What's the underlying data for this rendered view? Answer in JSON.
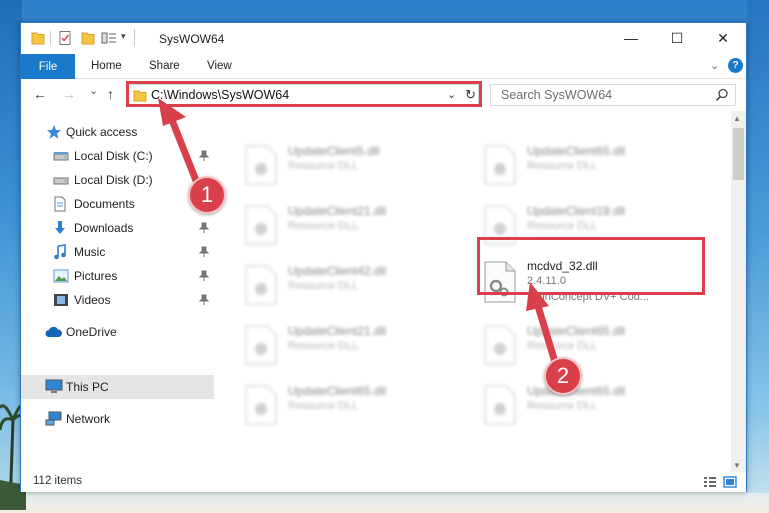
{
  "window": {
    "title": "SysWOW64",
    "minimize_glyph": "—",
    "maximize_glyph": "☐",
    "close_glyph": "✕"
  },
  "ribbon": {
    "tabs": [
      "File",
      "Home",
      "Share",
      "View"
    ],
    "collapse_glyph": "⌄",
    "help_glyph": "?"
  },
  "nav": {
    "back_glyph": "←",
    "forward_glyph": "→",
    "recent_glyph": "⌄",
    "up_glyph": "↑",
    "address": "C:\\Windows\\SysWOW64",
    "address_dropdown_glyph": "⌄",
    "refresh_glyph": "↻",
    "search_placeholder": "Search SysWOW64"
  },
  "sidebar": {
    "items": [
      {
        "label": "Quick access",
        "icon": "star-icon"
      },
      {
        "label": "Local Disk (C:)",
        "icon": "drive-icon",
        "pinned": true
      },
      {
        "label": "Local Disk (D:)",
        "icon": "drive-icon"
      },
      {
        "label": "Documents",
        "icon": "documents-icon"
      },
      {
        "label": "Downloads",
        "icon": "download-icon",
        "pinned": true
      },
      {
        "label": "Music",
        "icon": "music-icon",
        "pinned": true
      },
      {
        "label": "Pictures",
        "icon": "pictures-icon",
        "pinned": true
      },
      {
        "label": "Videos",
        "icon": "videos-icon",
        "pinned": true
      },
      {
        "label": "OneDrive",
        "icon": "cloud-icon"
      },
      {
        "label": "This PC",
        "icon": "computer-icon",
        "selected": true
      },
      {
        "label": "Network",
        "icon": "network-icon"
      }
    ]
  },
  "files": {
    "left": [
      {
        "name": "UpdateClient5.dll",
        "desc": "Resource DLL"
      },
      {
        "name": "UpdateClient21.dll",
        "desc": "Resource DLL"
      },
      {
        "name": "UpdateClient42.dll",
        "desc": "Resource DLL"
      },
      {
        "name": "UpdateClient21.dll",
        "desc": "Resource DLL"
      },
      {
        "name": "UpdateClient65.dll",
        "desc": "Resource DLL"
      }
    ],
    "right": [
      {
        "name": "UpdateClient65.dll",
        "desc": "Resource DLL"
      },
      {
        "name": "UpdateClient19.dll",
        "desc": "Resource DLL"
      },
      {
        "name": "mcdvd_32.dll",
        "version": "2.4.11.0",
        "desc": "MainConcept DV+ Cod...",
        "focused": true
      },
      {
        "name": "UpdateClient65.dll",
        "desc": "Resource DLL"
      },
      {
        "name": "UpdateClient65.dll",
        "desc": "Resource DLL"
      }
    ]
  },
  "status": {
    "item_count": "112 items"
  },
  "callouts": [
    "1",
    "2"
  ],
  "colors": {
    "accent": "#1979ca",
    "callout": "#d9404a",
    "folder": "#f5c542"
  }
}
